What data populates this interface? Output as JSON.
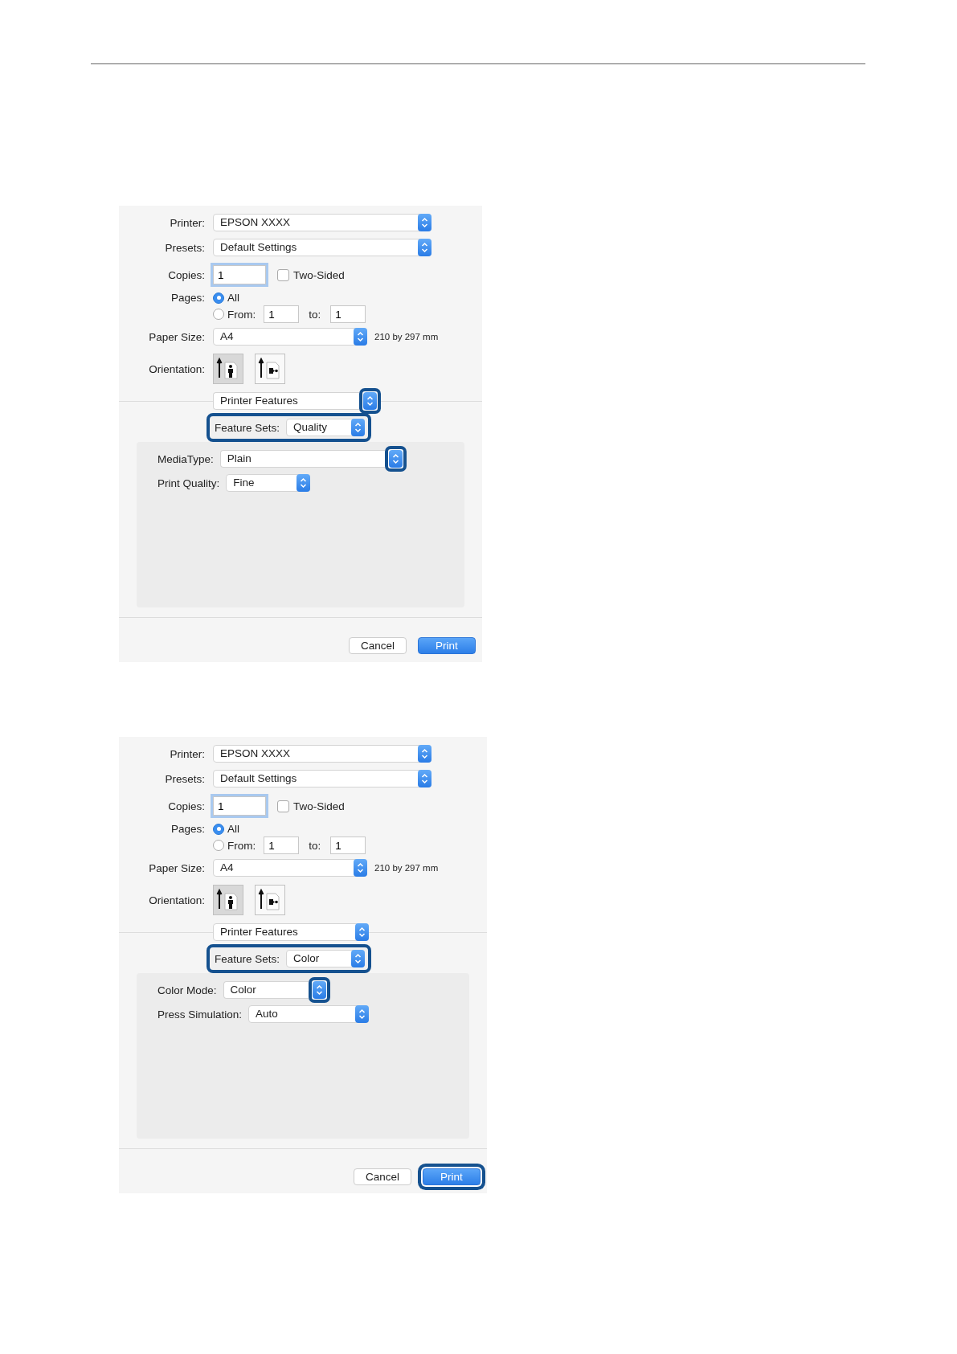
{
  "dialogs": [
    {
      "printer": {
        "label": "Printer:",
        "value": "EPSON XXXX"
      },
      "presets": {
        "label": "Presets:",
        "value": "Default Settings"
      },
      "copies": {
        "label": "Copies:",
        "value": "1",
        "focused": true
      },
      "two_sided": {
        "label": "Two-Sided",
        "checked": false
      },
      "pages": {
        "label": "Pages:",
        "options": [
          {
            "label": "All",
            "selected": true
          },
          {
            "label": "From:",
            "selected": false
          }
        ],
        "from": "1",
        "to_label": "to:",
        "to": "1"
      },
      "paper_size": {
        "label": "Paper Size:",
        "value": "A4",
        "dimensions": "210 by 297 mm"
      },
      "orientation": {
        "label": "Orientation:",
        "options": [
          {
            "kind": "portrait",
            "selected": true
          },
          {
            "kind": "landscape",
            "selected": false
          }
        ]
      },
      "panel_menu": {
        "value": "Printer Features",
        "highlighted": true
      },
      "feature_sets": {
        "label": "Feature Sets:",
        "value": "Quality",
        "highlighted": true
      },
      "settings": [
        {
          "label": "MediaType:",
          "value": "Plain",
          "highlighted": true
        },
        {
          "label": "Print Quality:",
          "value": "Fine",
          "highlighted": false
        }
      ],
      "buttons": [
        {
          "kind": "cancel",
          "label": "Cancel",
          "highlighted": false
        },
        {
          "kind": "default",
          "label": "Print",
          "highlighted": false
        }
      ]
    },
    {
      "printer": {
        "label": "Printer:",
        "value": "EPSON XXXX"
      },
      "presets": {
        "label": "Presets:",
        "value": "Default Settings"
      },
      "copies": {
        "label": "Copies:",
        "value": "1",
        "focused": true
      },
      "two_sided": {
        "label": "Two-Sided",
        "checked": false
      },
      "pages": {
        "label": "Pages:",
        "options": [
          {
            "label": "All",
            "selected": true
          },
          {
            "label": "From:",
            "selected": false
          }
        ],
        "from": "1",
        "to_label": "to:",
        "to": "1"
      },
      "paper_size": {
        "label": "Paper Size:",
        "value": "A4",
        "dimensions": "210 by 297 mm"
      },
      "orientation": {
        "label": "Orientation:",
        "options": [
          {
            "kind": "portrait",
            "selected": true
          },
          {
            "kind": "landscape",
            "selected": false
          }
        ]
      },
      "panel_menu": {
        "value": "Printer Features",
        "highlighted": false
      },
      "feature_sets": {
        "label": "Feature Sets:",
        "value": "Color",
        "highlighted": true
      },
      "settings": [
        {
          "label": "Color Mode:",
          "value": "Color",
          "highlighted": true
        },
        {
          "label": "Press Simulation:",
          "value": "Auto",
          "highlighted": false
        }
      ],
      "buttons": [
        {
          "kind": "cancel",
          "label": "Cancel",
          "highlighted": false
        },
        {
          "kind": "default",
          "label": "Print",
          "highlighted": true
        }
      ]
    }
  ]
}
